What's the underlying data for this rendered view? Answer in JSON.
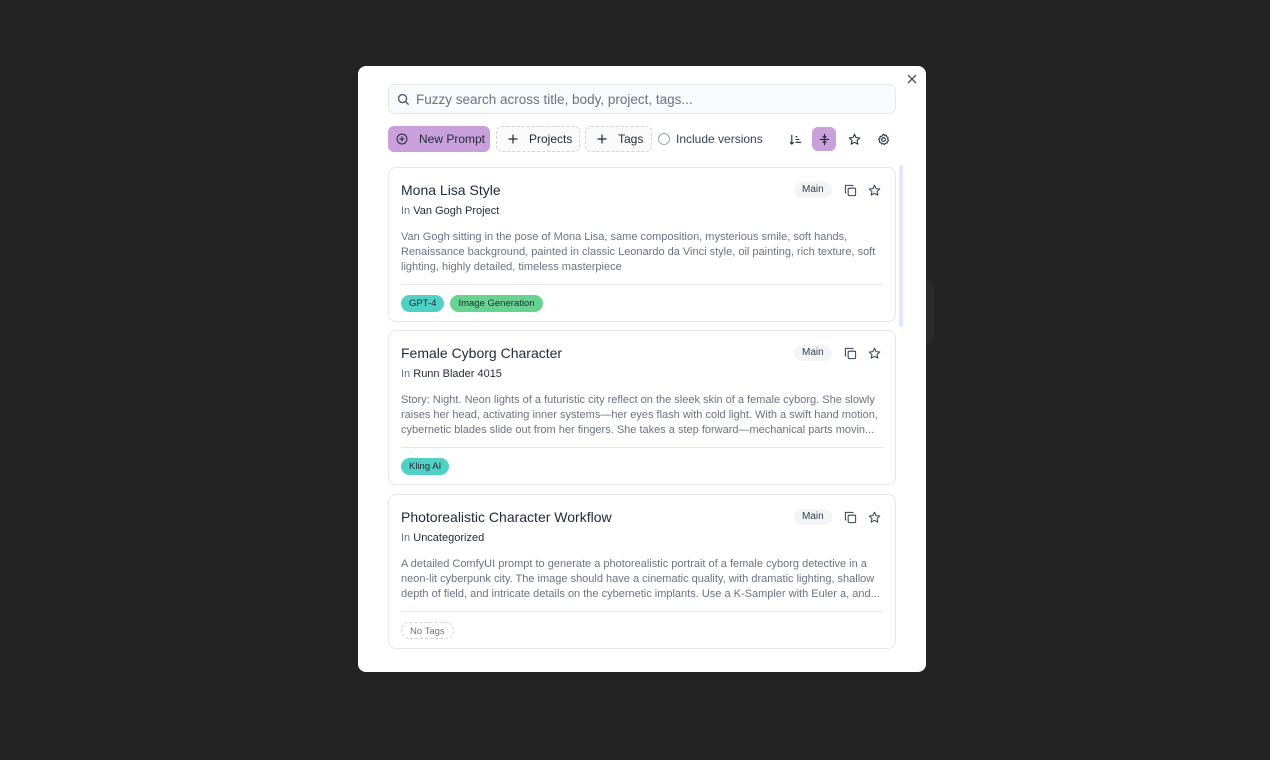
{
  "search": {
    "placeholder": "Fuzzy search across title, body, project, tags..."
  },
  "toolbar": {
    "new_prompt_label": "New Prompt",
    "projects_label": "Projects",
    "tags_label": "Tags",
    "include_versions_label": "Include versions"
  },
  "colors": {
    "accent": "#c9a0dc",
    "tag_teal": "#4fd1c5",
    "tag_green": "#68d391",
    "backdrop": "#232323"
  },
  "prompts": [
    {
      "title": "Mona Lisa Style",
      "in_label": "In",
      "project": "Van Gogh Project",
      "branch": "Main",
      "body": "Van Gogh sitting in the pose of Mona Lisa, same composition, mysterious smile, soft hands, Renaissance background, painted in classic Leonardo da Vinci style, oil painting, rich texture, soft lighting, highly detailed, timeless masterpiece",
      "tags": [
        "GPT-4",
        "Image Generation"
      ]
    },
    {
      "title": "Female Cyborg Character",
      "in_label": "In",
      "project": "Runn Blader 4015",
      "branch": "Main",
      "body": "Story: Night. Neon lights of a futuristic city reflect on the sleek skin of a female cyborg. She slowly raises her head, activating inner systems—her eyes flash with cold light. With a swift hand motion, cybernetic blades slide out from her fingers. She takes a step forward—mechanical parts movin...",
      "tags": [
        "Kling AI"
      ]
    },
    {
      "title": "Photorealistic Character Workflow",
      "in_label": "In",
      "project": "Uncategorized",
      "branch": "Main",
      "body": "A detailed ComfyUI prompt to generate a photorealistic portrait of a female cyborg detective in a neon-lit cyberpunk city. The image should have a cinematic quality, with dramatic lighting, shallow depth of field, and intricate details on the cybernetic implants. Use a K-Sampler with Euler a, and...",
      "tags": [],
      "no_tags_label": "No Tags"
    }
  ]
}
